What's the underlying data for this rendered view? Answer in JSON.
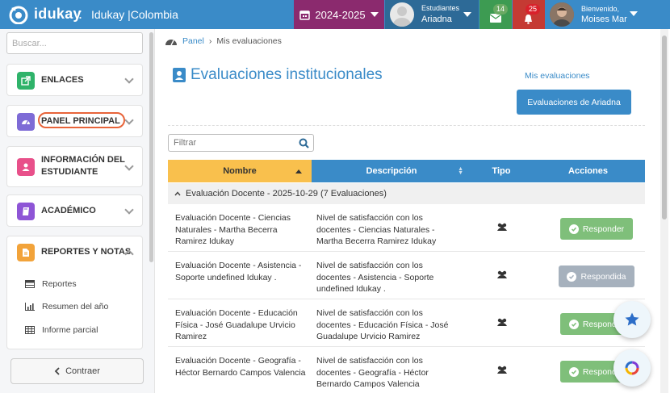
{
  "topbar": {
    "brand": "idukay",
    "separator": ":",
    "school": "Idukay |Colombia",
    "year": "2024-2025",
    "student_label": "Estudiantes",
    "student_name": "Ariadna",
    "mail_count": "14",
    "notif_count": "25",
    "welcome": "Bienvenido,",
    "user_name": "Moises Mar"
  },
  "sidebar": {
    "search_placeholder": "Buscar...",
    "menus": [
      {
        "label": "ENLACES",
        "color": "#2fb36a"
      },
      {
        "label": "PANEL PRINCIPAL",
        "color": "#7e6bd6"
      },
      {
        "label": "INFORMACIÓN DEL ESTUDIANTE",
        "label_line1": "INFORMACIÓN DEL",
        "label_line2": "ESTUDIANTE",
        "color": "#e8508a"
      },
      {
        "label": "ACADÉMICO",
        "color": "#8e55d6"
      },
      {
        "label": "REPORTES Y NOTAS",
        "color": "#f2a33a"
      }
    ],
    "submenu": [
      "Reportes",
      "Resumen del año",
      "Informe parcial"
    ],
    "collapse_label": "Contraer"
  },
  "breadcrumb": {
    "home": "Panel",
    "current": "Mis evaluaciones"
  },
  "page": {
    "title": "Evaluaciones institucionales",
    "my_link": "Mis evaluaciones",
    "ariadna_button": "Evaluaciones de Ariadna",
    "filter_placeholder": "Filtrar"
  },
  "table": {
    "headers": [
      "Nombre",
      "Descripción",
      "Tipo",
      "Acciones"
    ],
    "group_label": "Evaluación Docente - 2025-10-29 (7 Evaluaciones)",
    "rows": [
      {
        "name": "Evaluación Docente - Ciencias Naturales - Martha Becerra Ramirez Idukay",
        "description": "Nivel de satisfacción con los docentes - Ciencias Naturales - Martha Becerra Ramirez Idukay",
        "action": "Responder",
        "state": "pending"
      },
      {
        "name": "Evaluación Docente - Asistencia - Soporte undefined Idukay .",
        "description": "Nivel de satisfacción con los docentes - Asistencia - Soporte undefined Idukay .",
        "action": "Respondida",
        "state": "done"
      },
      {
        "name": "Evaluación Docente - Educación Física - José Guadalupe Urvicio Ramirez",
        "description": "Nivel de satisfacción con los docentes - Educación Física - José Guadalupe Urvicio Ramirez",
        "action": "Responder",
        "state": "pending"
      },
      {
        "name": "Evaluación Docente - Geografía - Héctor Bernardo Campos Valencia",
        "description": "Nivel de satisfacción con los docentes - Geografía - Héctor Bernardo Campos Valencia",
        "action": "Responder",
        "state": "pending"
      }
    ]
  },
  "colors": {
    "primary": "#3a8bc8",
    "year_bg": "#8b2a6e",
    "respond_green": "#7fbf7a",
    "answered_grey": "#a6b1bd",
    "sort_active": "#f9c04d"
  }
}
